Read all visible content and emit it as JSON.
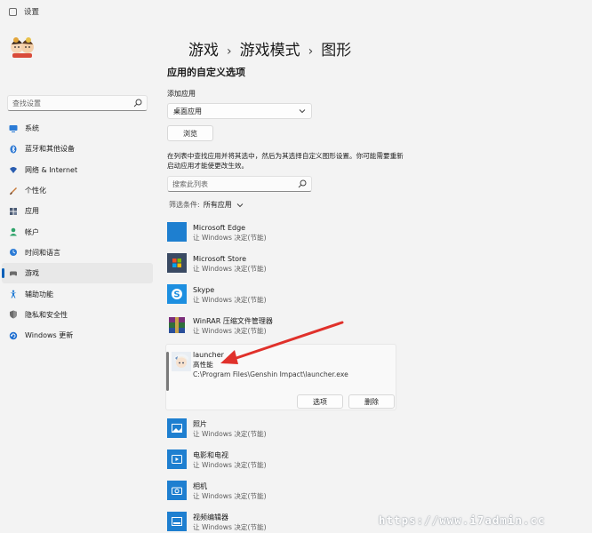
{
  "window": {
    "title": "设置"
  },
  "sidebar": {
    "search_placeholder": "查找设置",
    "items": [
      {
        "label": "系统",
        "icon": "monitor-icon",
        "color": "#2b7bd6"
      },
      {
        "label": "蓝牙和其他设备",
        "icon": "bluetooth-icon",
        "color": "#1f6fd0"
      },
      {
        "label": "网络 & Internet",
        "icon": "wifi-icon",
        "color": "#2a5db0"
      },
      {
        "label": "个性化",
        "icon": "brush-icon",
        "color": "#c87b3a"
      },
      {
        "label": "应用",
        "icon": "apps-icon",
        "color": "#4b5b74"
      },
      {
        "label": "帐户",
        "icon": "person-icon",
        "color": "#2ea36a"
      },
      {
        "label": "时间和语言",
        "icon": "globe-clock-icon",
        "color": "#2b7bd6"
      },
      {
        "label": "游戏",
        "icon": "gamepad-icon",
        "color": "#6b6b6b",
        "active": true
      },
      {
        "label": "辅助功能",
        "icon": "accessibility-icon",
        "color": "#1c78d4"
      },
      {
        "label": "隐私和安全性",
        "icon": "shield-icon",
        "color": "#6b6b6b"
      },
      {
        "label": "Windows 更新",
        "icon": "update-icon",
        "color": "#1f6fd0"
      }
    ]
  },
  "breadcrumb": {
    "part1": "游戏",
    "part2": "游戏模式",
    "part3": "图形"
  },
  "main": {
    "section_title": "应用的自定义选项",
    "add_app_label": "添加应用",
    "dropdown_value": "桌面应用",
    "browse_label": "浏览",
    "description": "在列表中查找应用并将其选中，然后为其选择自定义图形设置。你可能需要重新启动应用才能使更改生效。",
    "list_search_placeholder": "搜索此列表",
    "filter_label": "筛选条件:",
    "filter_value": "所有应用"
  },
  "apps": [
    {
      "name": "Microsoft Edge",
      "sub": "让 Windows 决定(节能)",
      "icon": "edge-tile-icon",
      "color": "#1e7fd0"
    },
    {
      "name": "Microsoft Store",
      "sub": "让 Windows 决定(节能)",
      "icon": "store-tile-icon",
      "color": "#3a4a63"
    },
    {
      "name": "Skype",
      "sub": "让 Windows 决定(节能)",
      "icon": "skype-tile-icon",
      "color": "#1d8fe0"
    },
    {
      "name": "WinRAR 压缩文件管理器",
      "sub": "让 Windows 决定(节能)",
      "icon": "winrar-tile-icon",
      "color": "#6a2a6e"
    },
    {
      "name": "照片",
      "sub": "让 Windows 决定(节能)",
      "icon": "photos-tile-icon",
      "color": "#1e7fd0"
    },
    {
      "name": "电影和电视",
      "sub": "让 Windows 决定(节能)",
      "icon": "movies-tile-icon",
      "color": "#1e7fd0"
    },
    {
      "name": "相机",
      "sub": "让 Windows 决定(节能)",
      "icon": "camera-tile-icon",
      "color": "#1e7fd0"
    },
    {
      "name": "视频编辑器",
      "sub": "让 Windows 决定(节能)",
      "icon": "video-editor-tile-icon",
      "color": "#1e7fd0"
    }
  ],
  "expanded_app": {
    "name": "launcher",
    "status": "高性能",
    "path": "C:\\Program Files\\Genshin Impact\\launcher.exe",
    "options_label": "选项",
    "delete_label": "删除",
    "icon": "genshin-launcher-icon"
  },
  "annotation": {
    "arrow_color": "#e0312b"
  },
  "watermark": "https://www.i7admin.cc",
  "colors": {
    "accent": "#005fb8",
    "background": "#f3f3f3"
  }
}
